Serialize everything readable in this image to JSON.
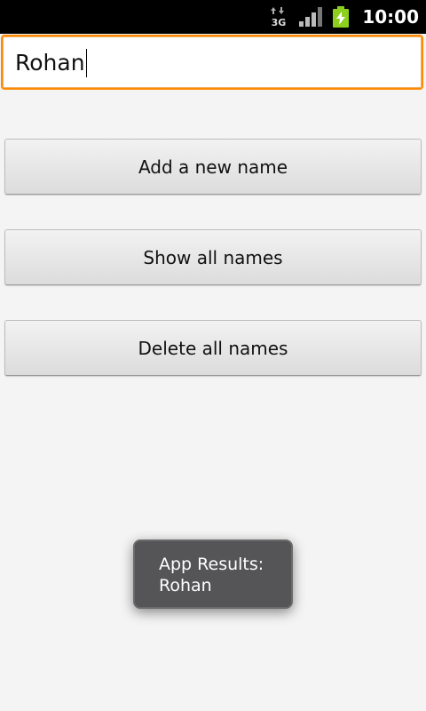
{
  "status_bar": {
    "network_icon": "3g-data-icon",
    "network_label": "3G",
    "signal_icon": "signal-strength-icon",
    "battery_icon": "battery-charging-icon",
    "time": "10:00"
  },
  "name_input": {
    "value": "Rohan",
    "focus_color": "#ff8a00"
  },
  "buttons": {
    "add": "Add a new name",
    "show": "Show all names",
    "delete": "Delete all names"
  },
  "toast": {
    "line1": "App Results:",
    "line2": "Rohan"
  }
}
